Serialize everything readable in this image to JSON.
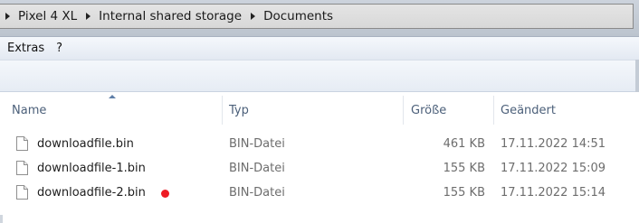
{
  "address_bar": {
    "breadcrumbs": [
      "Pixel 4 XL",
      "Internal shared storage",
      "Documents"
    ]
  },
  "menu": {
    "items": [
      "Extras",
      "?"
    ]
  },
  "columns": {
    "name": "Name",
    "type": "Typ",
    "size": "Größe",
    "modified": "Geändert",
    "sorted_by": "Name",
    "sort_direction": "ascending"
  },
  "files": [
    {
      "name": "downloadfile.bin",
      "type": "BIN-Datei",
      "size": "461 KB",
      "modified": "17.11.2022 14:51",
      "icon": "file-icon",
      "marker": null
    },
    {
      "name": "downloadfile-1.bin",
      "type": "BIN-Datei",
      "size": "155 KB",
      "modified": "17.11.2022 15:09",
      "icon": "file-icon",
      "marker": null
    },
    {
      "name": "downloadfile-2.bin",
      "type": "BIN-Datei",
      "size": "155 KB",
      "modified": "17.11.2022 15:14",
      "icon": "file-icon",
      "marker": "red-dot"
    }
  ],
  "colors": {
    "header_text": "#4c607a",
    "marker": "#ee1b24"
  }
}
